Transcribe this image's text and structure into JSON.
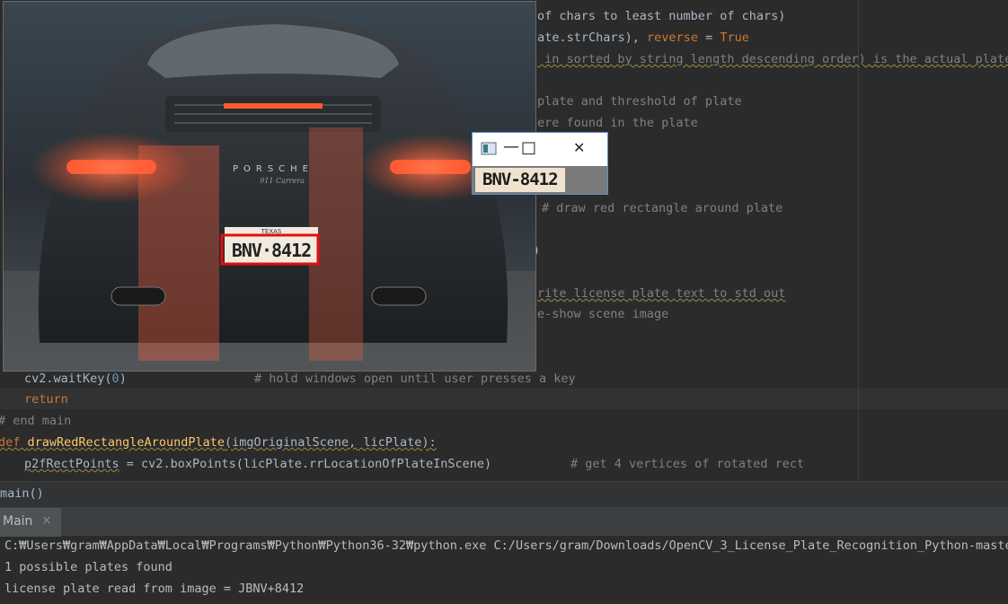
{
  "editor": {
    "lines": [
      {
        "text": "of chars to least number of chars)"
      },
      {
        "pre": "late.strChars), ",
        "kw": "reverse",
        "post": " = ",
        "kw2": "True"
      },
      {
        "text": " in sorted by string length descending order) is the actual plate"
      },
      {
        "text": "plate and threshold of plate"
      },
      {
        "text": "ere found in the plate"
      },
      {
        "text": "# draw red rectangle around plate"
      },
      {
        "text": ")"
      },
      {
        "text": "rite license plate text to std out"
      },
      {
        "text": "e-show scene image"
      },
      {
        "code": "cv2.waitKey(",
        "num": "0",
        "code2": ")",
        "comment": "# hold windows open until user presses a key"
      },
      {
        "kw": "return"
      },
      {
        "comment": "# end main"
      },
      {
        "kw": "def ",
        "fn": "drawRedRectangleAroundPlate",
        "code": "(imgOriginalScene, licPlate):"
      },
      {
        "code": "p2fRectPoints",
        "code2": " = cv2.boxPoints(licPlate.rrLocationOfPlateInScene)",
        "comment": "# get 4 vertices of rotated rect"
      }
    ]
  },
  "breadcrumb": {
    "text": "main()"
  },
  "run_panel": {
    "tab_label": "Main",
    "close_glyph": "×"
  },
  "console": {
    "lines": [
      "C:₩Users₩gram₩AppData₩Local₩Programs₩Python₩Python36-32₩python.exe C:/Users/gram/Downloads/OpenCV_3_License_Plate_Recognition_Python-master/",
      "1 possible plates found",
      "license plate read from image = JBNV+8412"
    ]
  },
  "scene_image": {
    "brand": "PORSCHE",
    "model": "911 Carrera",
    "plate_state": "TEXAS",
    "plate_text": "BNV·8412"
  },
  "plate_window": {
    "minimize": "—",
    "maximize": "□",
    "close": "✕",
    "plate_text": "BNV-8412"
  },
  "colors": {
    "highlight_rect": "#e01010",
    "keyword": "#cc7832",
    "comment": "#808080",
    "function": "#ffc66d"
  }
}
